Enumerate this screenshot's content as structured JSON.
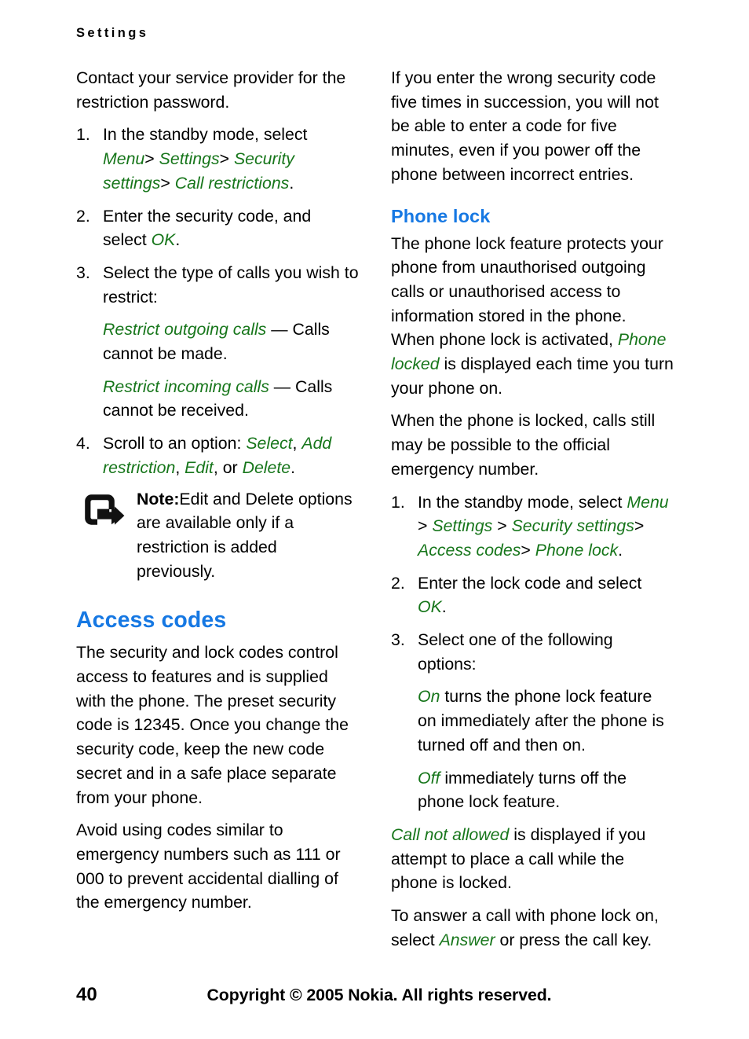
{
  "document": {
    "running_header": "Settings",
    "page_number": "40",
    "copyright": "Copyright © 2005 Nokia. All rights reserved."
  },
  "colors": {
    "heading_blue": "#1678e3",
    "ui_term_green": "#17761b",
    "body_black": "#000000",
    "page_background": "#ffffff"
  },
  "left_column": {
    "intro": "Contact your service provider for the restriction password.",
    "steps": [
      {
        "num": "1.",
        "lead": "In the standby mode, select",
        "path": [
          "Menu",
          "Settings",
          "Security settings",
          "Call restrictions"
        ],
        "path_separator": ">",
        "trailing": "."
      },
      {
        "num": "2.",
        "lead_a": "Enter the security code, and select",
        "ui": "OK",
        "trailing": "."
      },
      {
        "num": "3.",
        "lead": "Select the type of calls you wish to restrict:",
        "substeps": [
          {
            "ui": "Restrict outgoing calls",
            "dash": "—",
            "text": "Calls cannot be made."
          },
          {
            "ui": "Restrict incoming calls",
            "dash": "—",
            "text": "Calls cannot be received."
          }
        ]
      },
      {
        "num": "4.",
        "lead_a": "Scroll to an option:",
        "options": [
          "Select",
          "Add restriction",
          "Edit",
          "Delete"
        ],
        "conjunction": "or",
        "trailing": "."
      }
    ],
    "note": {
      "icon": "note-arrow-icon",
      "label": "Note:",
      "text": "Edit and Delete options are available only if a restriction is added previously."
    },
    "heading": "Access codes",
    "paragraphs": [
      "The security and lock codes control access to features and is supplied with the phone. The preset security code is 12345. Once you change the security code, keep the new code secret and in a safe place separate from your phone.",
      "Avoid using codes similar to emergency numbers such as 111 or 000 to prevent accidental dialling of the emergency number."
    ]
  },
  "right_column": {
    "intro": "If you enter the wrong security code five times in succession, you will not be able to enter a code for five minutes, even if you power off the phone between incorrect entries.",
    "heading": "Phone lock",
    "para_1_a": "The phone lock feature protects your phone from unauthorised outgoing calls or unauthorised access to information stored in the phone. When phone lock is activated,",
    "para_1_ui": "Phone locked",
    "para_1_b": "is displayed each time you turn your phone on.",
    "para_2": "When the phone is locked, calls still may be possible to the official emergency number.",
    "steps": [
      {
        "num": "1.",
        "lead": "In the standby mode, select",
        "path": [
          "Menu",
          "Settings",
          "Security settings",
          "Access codes",
          "Phone lock"
        ],
        "path_separator": ">",
        "trailing": "."
      },
      {
        "num": "2.",
        "lead_a": "Enter the lock code and select",
        "ui": "OK",
        "trailing": "."
      },
      {
        "num": "3.",
        "lead": "Select one of the following options:",
        "substeps": [
          {
            "ui": "On",
            "text": "turns the phone lock feature on immediately after the phone is turned off and then on."
          },
          {
            "ui": "Off",
            "text": "immediately turns off the phone lock feature."
          }
        ]
      }
    ],
    "para_3_ui": "Call not allowed",
    "para_3_text": "is displayed if you attempt to place a call while the phone is locked.",
    "para_4_a": "To answer a call with phone lock on, select",
    "para_4_ui": "Answer",
    "para_4_b": "or press the call key."
  }
}
